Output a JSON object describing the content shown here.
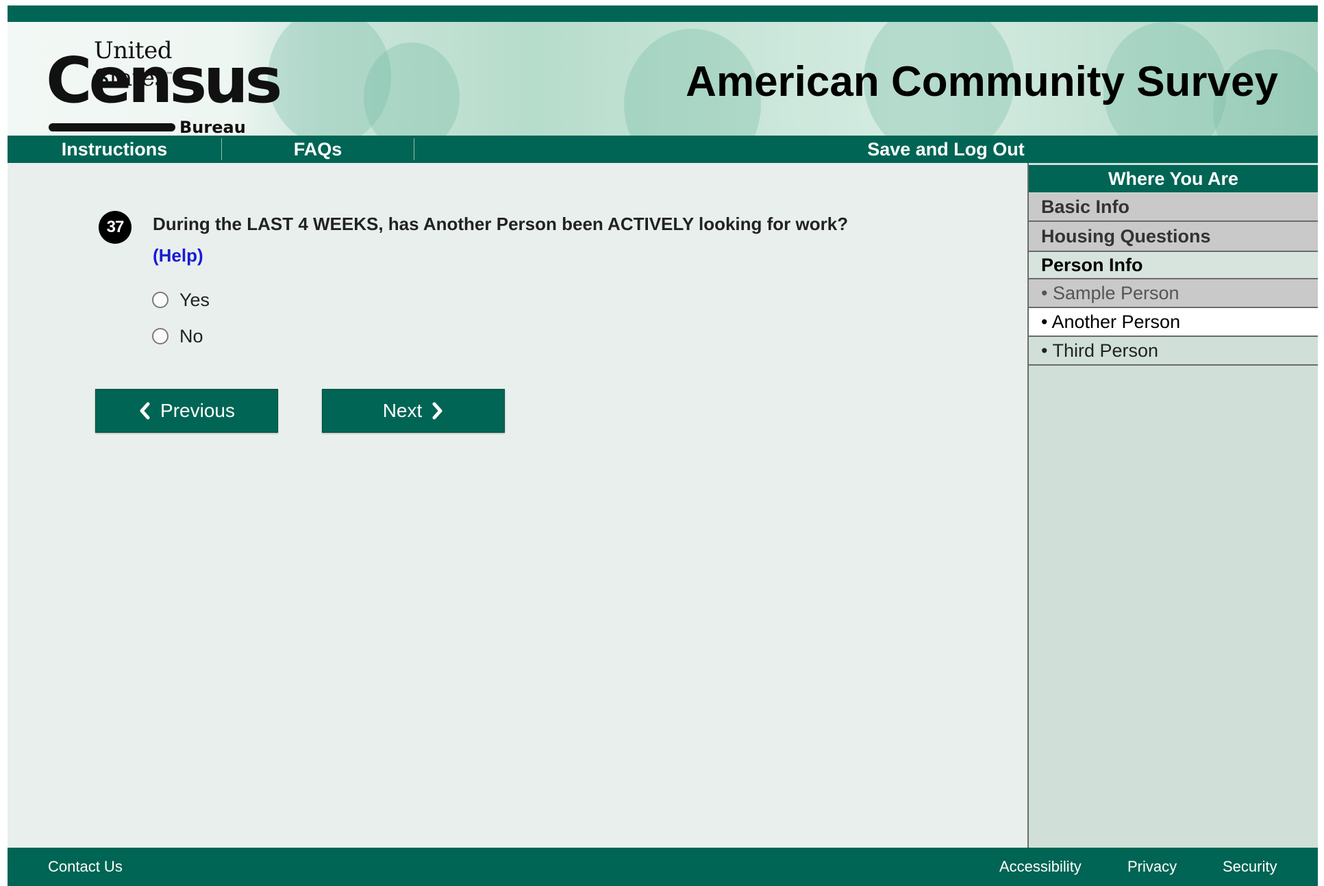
{
  "header": {
    "logo": {
      "line1": "United States",
      "tm": "™",
      "line2": "Census",
      "line3": "Bureau"
    },
    "title": "American Community Survey"
  },
  "nav": {
    "instructions": "Instructions",
    "faqs": "FAQs",
    "save_logout": "Save and Log Out"
  },
  "question": {
    "number": "37",
    "text": "During the LAST 4 WEEKS, has Another Person been ACTIVELY looking for work?",
    "help": "(Help)",
    "options": [
      "Yes",
      "No"
    ],
    "selected": null
  },
  "buttons": {
    "previous": "Previous",
    "next": "Next"
  },
  "sidebar": {
    "title": "Where You Are",
    "sections": [
      "Basic Info",
      "Housing Questions",
      "Person Info"
    ],
    "people": [
      "• Sample Person",
      "• Another Person",
      "• Third Person"
    ],
    "current_person": "• Another Person"
  },
  "footer": {
    "contact": "Contact Us",
    "accessibility": "Accessibility",
    "privacy": "Privacy",
    "security": "Security"
  },
  "colors": {
    "brand_green": "#006554",
    "main_bg": "#e8efec",
    "sidebar_bg": "#d0e0d9",
    "help_link": "#1a1ad6"
  }
}
